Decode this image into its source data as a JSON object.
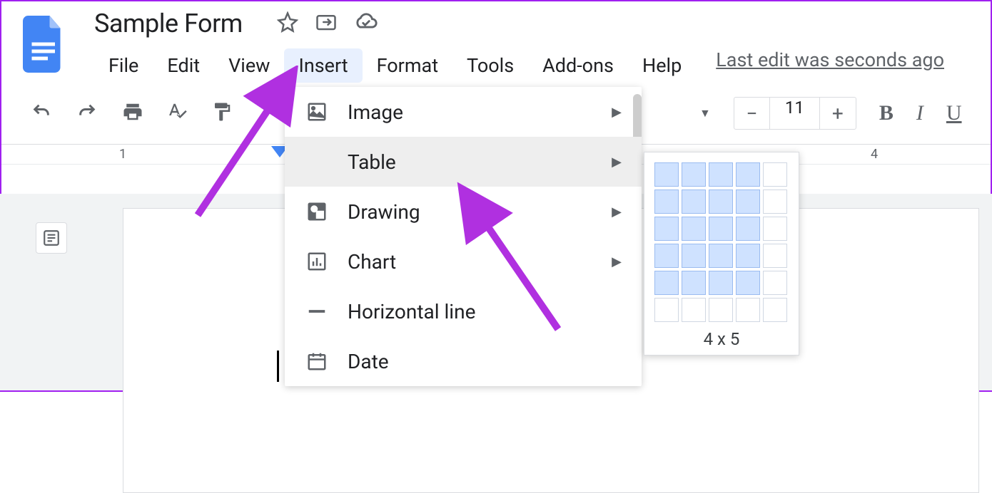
{
  "header": {
    "doc_title": "Sample Form",
    "last_edit": "Last edit was seconds ago"
  },
  "menubar": {
    "items": [
      "File",
      "Edit",
      "View",
      "Insert",
      "Format",
      "Tools",
      "Add-ons",
      "Help"
    ],
    "active_index": 3
  },
  "toolbar": {
    "font_size": "11"
  },
  "ruler": {
    "tick_left": "1",
    "tick_right": "4"
  },
  "insert_menu": {
    "items": [
      {
        "icon": "image-icon",
        "label": "Image",
        "has_submenu": true
      },
      {
        "icon": "table-icon",
        "label": "Table",
        "has_submenu": true,
        "hover": true
      },
      {
        "icon": "drawing-icon",
        "label": "Drawing",
        "has_submenu": true
      },
      {
        "icon": "chart-icon",
        "label": "Chart",
        "has_submenu": true
      },
      {
        "icon": "hr-icon",
        "label": "Horizontal line",
        "has_submenu": false
      },
      {
        "icon": "date-icon",
        "label": "Date",
        "has_submenu": false
      }
    ]
  },
  "table_picker": {
    "cols": 4,
    "rows": 5,
    "label": "4 x 5"
  }
}
